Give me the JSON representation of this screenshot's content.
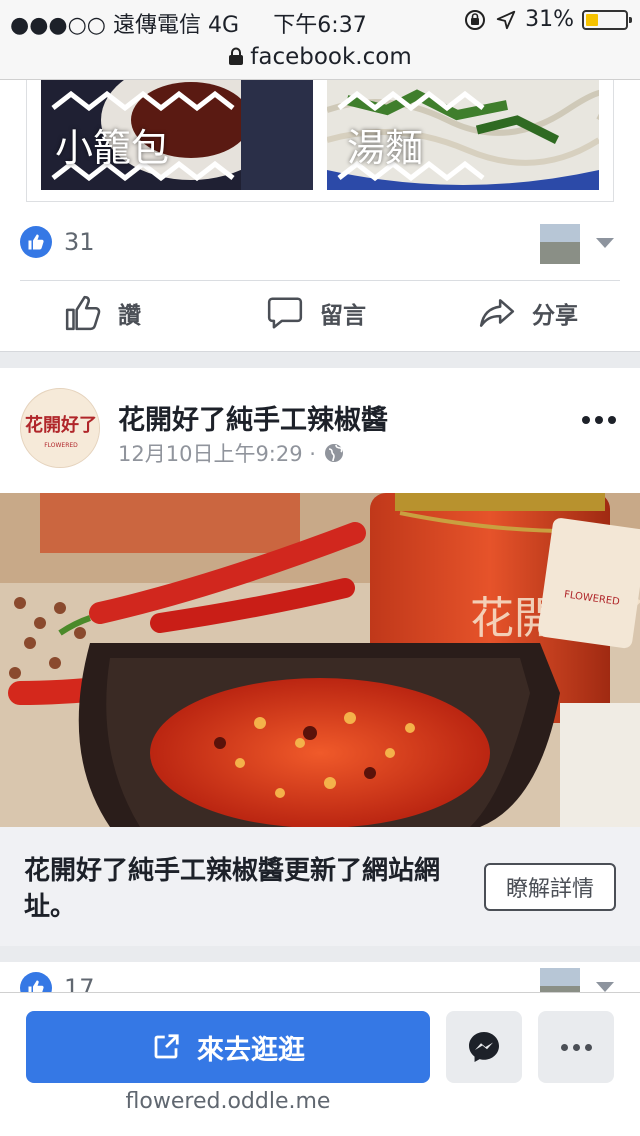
{
  "status": {
    "carrier": "●●●○○ 遠傳電信  4G",
    "time": "下午6:37",
    "battery": "31%",
    "battery_level": 0.31
  },
  "browser": {
    "url": "facebook.com"
  },
  "post1": {
    "thumbs": [
      {
        "label": "小籠包"
      },
      {
        "label": "湯麵"
      }
    ],
    "like_count": "31",
    "actions": {
      "like": "讚",
      "comment": "留言",
      "share": "分享"
    }
  },
  "post2": {
    "page_name": "花開好了純手工辣椒醬",
    "timestamp": "12月10日上午9:29 ·",
    "avatar_text": "花開好了",
    "avatar_brand": "FLOWERED",
    "jar_label": "花開好了",
    "tag_brand": "FLOWERED",
    "link_title": "花開好了純手工辣椒醬更新了網站網址。",
    "link_button": "瞭解詳情"
  },
  "post3": {
    "like_count": "17"
  },
  "footer": {
    "cta_label": "來去逛逛",
    "domain": "flowered.oddle.me"
  },
  "colors": {
    "facebook_blue": "#3578e5",
    "page_bg": "#e9ebee"
  }
}
